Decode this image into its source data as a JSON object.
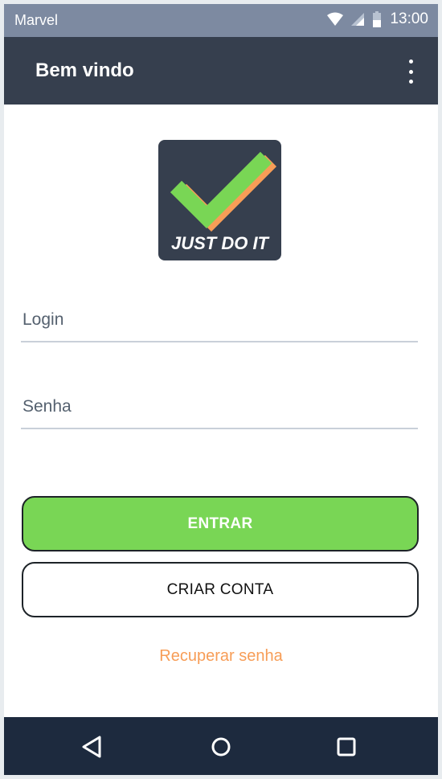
{
  "status_bar": {
    "carrier": "Marvel",
    "time": "13:00",
    "icons": [
      "wifi-icon",
      "signal-icon",
      "battery-icon"
    ]
  },
  "app_bar": {
    "title": "Bem vindo",
    "menu_icon": "more-vert-icon"
  },
  "logo": {
    "text": "JUST DO IT",
    "icon": "checkmark-icon",
    "colors": {
      "background": "#363f4e",
      "check": "#79d655",
      "shadow": "#f79d57"
    }
  },
  "form": {
    "login_placeholder": "Login",
    "login_value": "",
    "password_placeholder": "Senha",
    "password_value": ""
  },
  "buttons": {
    "enter_label": "ENTRAR",
    "create_account_label": "CRIAR CONTA"
  },
  "recover_link": "Recuperar senha",
  "nav_bar": {
    "icons": [
      "back-icon",
      "home-icon",
      "recents-icon"
    ]
  },
  "colors": {
    "primary_dark": "#363f4e",
    "status_bar": "#7d8aa1",
    "accent_green": "#79d655",
    "accent_orange": "#f79d57",
    "nav_bar": "#1d2a3e"
  }
}
